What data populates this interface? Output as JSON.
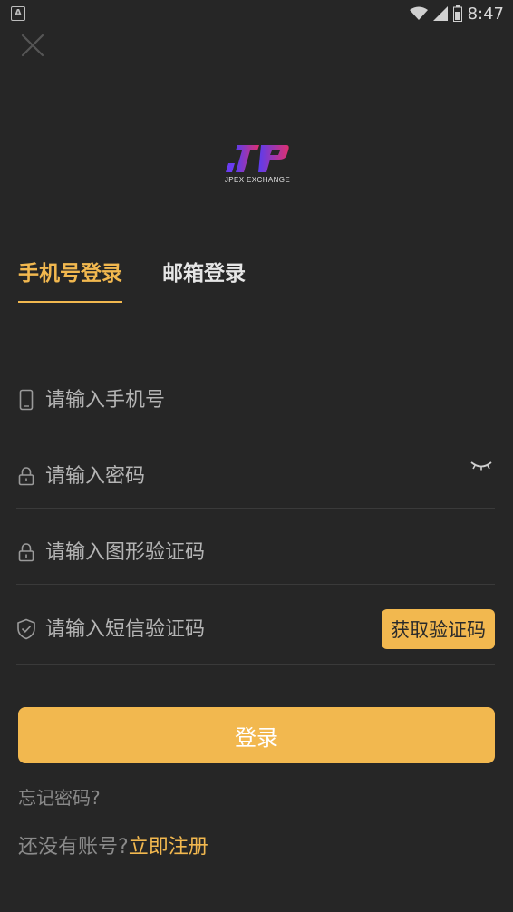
{
  "status_bar": {
    "time": "8:47",
    "app_badge": "A"
  },
  "logo": {
    "caption": "JPEX EXCHANGE"
  },
  "tabs": [
    {
      "label": "手机号登录",
      "active": true
    },
    {
      "label": "邮箱登录",
      "active": false
    }
  ],
  "form": {
    "phone": {
      "placeholder": "请输入手机号"
    },
    "password": {
      "placeholder": "请输入密码"
    },
    "captcha": {
      "placeholder": "请输入图形验证码"
    },
    "sms": {
      "placeholder": "请输入短信验证码",
      "button_label": "获取验证码"
    }
  },
  "login_button": "登录",
  "forgot_password": "忘记密码?",
  "signup": {
    "prompt": "还没有账号?",
    "link": "立即注册"
  },
  "colors": {
    "background": "#262626",
    "accent": "#f2b84f"
  }
}
